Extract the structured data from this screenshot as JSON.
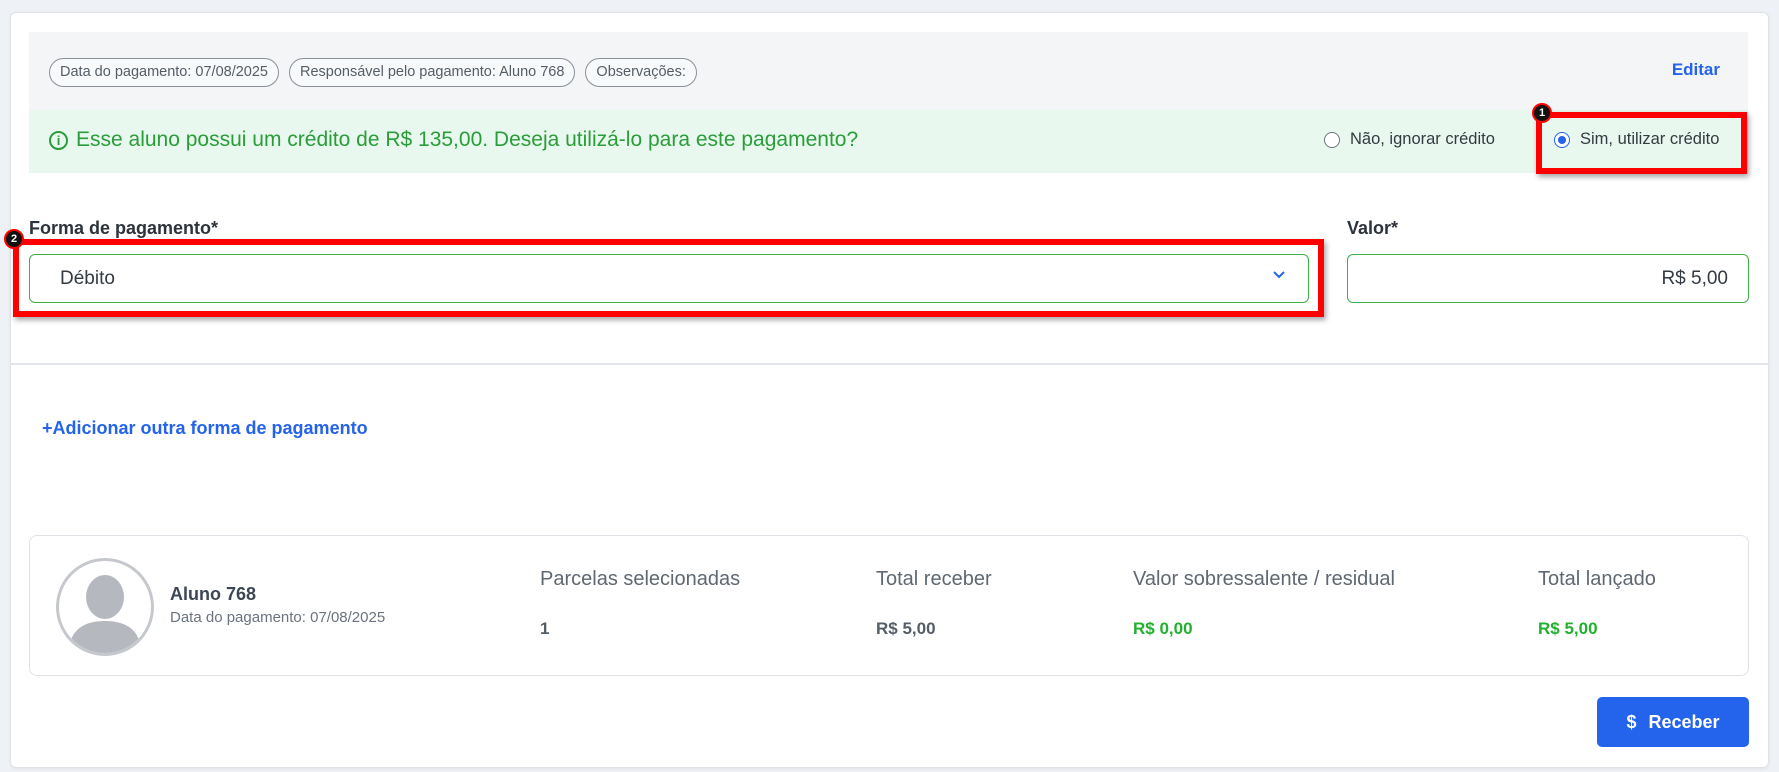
{
  "header": {
    "chips": [
      "Data do pagamento: 07/08/2025",
      "Responsável pelo pagamento: Aluno 768",
      "Observações:"
    ],
    "edit_label": "Editar"
  },
  "credit": {
    "message": "Esse aluno possui um crédito de R$ 135,00. Deseja utilizá-lo para este pagamento?",
    "option_ignore": "Não, ignorar crédito",
    "option_use": "Sim, utilizar crédito",
    "selected": "Sim, utilizar crédito"
  },
  "annotations": {
    "badge1": "1",
    "badge2": "2"
  },
  "payment": {
    "method_label": "Forma de pagamento*",
    "method_value": "Débito",
    "amount_label": "Valor*",
    "amount_value": "R$ 5,00"
  },
  "add_payment_label": "Adicionar outra forma de pagamento",
  "summary": {
    "student_name": "Aluno 768",
    "student_date": "Data do pagamento: 07/08/2025",
    "columns": [
      {
        "label": "Parcelas selecionadas",
        "value": "1"
      },
      {
        "label": "Total receber",
        "value": "R$ 5,00"
      },
      {
        "label": "Valor sobressalente / residual",
        "value": "R$ 0,00"
      },
      {
        "label": "Total lançado",
        "value": "R$ 5,00"
      }
    ]
  },
  "receber_label": "Receber",
  "colors": {
    "accent": "#2463eb",
    "success": "#22b02e",
    "highlight": "#ff0000",
    "credit_bg": "#e8f8ee"
  }
}
